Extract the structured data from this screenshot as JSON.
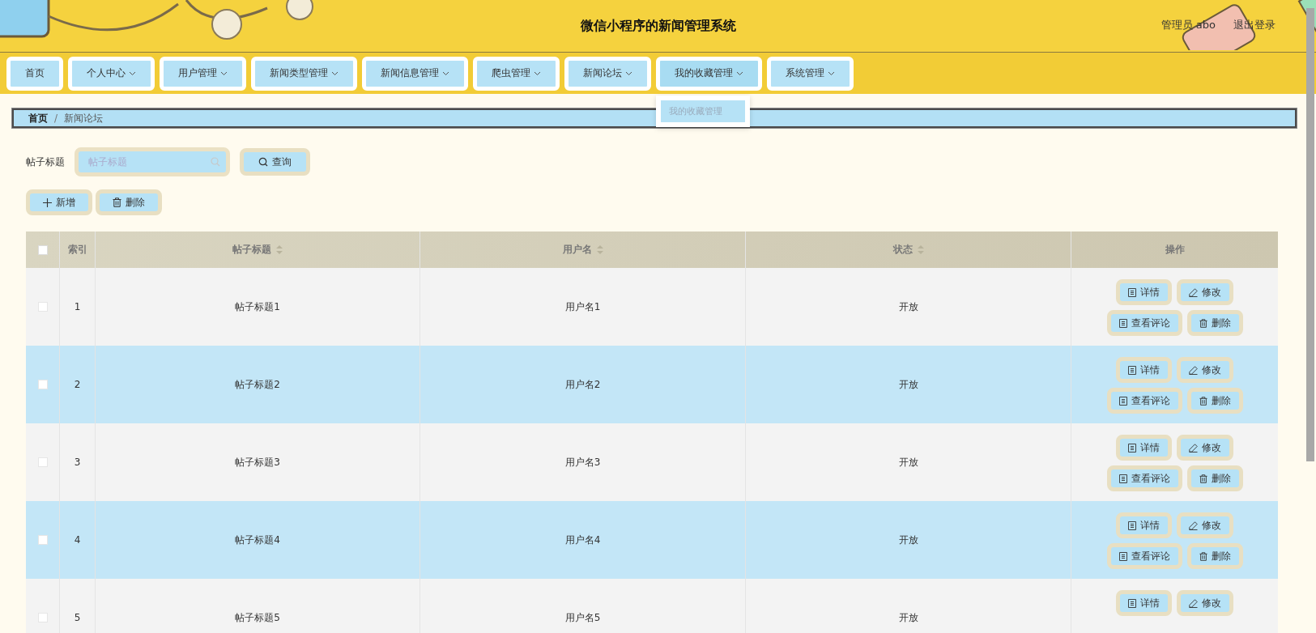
{
  "header": {
    "title": "微信小程序的新闻管理系统",
    "user": "管理员 abo",
    "logout": "退出登录"
  },
  "nav": [
    {
      "label": "首页",
      "dropdown": false,
      "open": false
    },
    {
      "label": "个人中心",
      "dropdown": true,
      "open": false
    },
    {
      "label": "用户管理",
      "dropdown": true,
      "open": false
    },
    {
      "label": "新闻类型管理",
      "dropdown": true,
      "open": false
    },
    {
      "label": "新闻信息管理",
      "dropdown": true,
      "open": false
    },
    {
      "label": "爬虫管理",
      "dropdown": true,
      "open": false
    },
    {
      "label": "新闻论坛",
      "dropdown": true,
      "open": false
    },
    {
      "label": "我的收藏管理",
      "dropdown": true,
      "open": true,
      "items": [
        "我的收藏管理"
      ]
    },
    {
      "label": "系统管理",
      "dropdown": true,
      "open": false
    }
  ],
  "breadcrumb": {
    "items": [
      "首页",
      "新闻论坛"
    ],
    "separator": "/"
  },
  "search": {
    "label": "帖子标题",
    "placeholder": "帖子标题",
    "button": "查询"
  },
  "actions": [
    {
      "kind": "add",
      "label": "新增"
    },
    {
      "kind": "delete",
      "label": "删除"
    }
  ],
  "table": {
    "select_all_checked": false,
    "columns": [
      {
        "label": "索引",
        "sortable": false
      },
      {
        "label": "帖子标题",
        "sortable": true
      },
      {
        "label": "用户名",
        "sortable": true
      },
      {
        "label": "状态",
        "sortable": true
      },
      {
        "label": "操作",
        "sortable": false
      }
    ],
    "rows": [
      {
        "checked": false,
        "index": "1",
        "title": "帖子标题1",
        "user": "用户名1",
        "status": "开放",
        "actions": [
          {
            "kind": "detail",
            "label": "详情"
          },
          {
            "kind": "edit",
            "label": "修改"
          },
          {
            "kind": "comments",
            "label": "查看评论"
          },
          {
            "kind": "delete",
            "label": "删除"
          }
        ]
      },
      {
        "checked": false,
        "index": "2",
        "title": "帖子标题2",
        "user": "用户名2",
        "status": "开放",
        "actions": [
          {
            "kind": "detail",
            "label": "详情"
          },
          {
            "kind": "edit",
            "label": "修改"
          },
          {
            "kind": "comments",
            "label": "查看评论"
          },
          {
            "kind": "delete",
            "label": "删除"
          }
        ]
      },
      {
        "checked": false,
        "index": "3",
        "title": "帖子标题3",
        "user": "用户名3",
        "status": "开放",
        "actions": [
          {
            "kind": "detail",
            "label": "详情"
          },
          {
            "kind": "edit",
            "label": "修改"
          },
          {
            "kind": "comments",
            "label": "查看评论"
          },
          {
            "kind": "delete",
            "label": "删除"
          }
        ]
      },
      {
        "checked": false,
        "index": "4",
        "title": "帖子标题4",
        "user": "用户名4",
        "status": "开放",
        "actions": [
          {
            "kind": "detail",
            "label": "详情"
          },
          {
            "kind": "edit",
            "label": "修改"
          },
          {
            "kind": "comments",
            "label": "查看评论"
          },
          {
            "kind": "delete",
            "label": "删除"
          }
        ]
      },
      {
        "checked": false,
        "index": "5",
        "title": "帖子标题5",
        "user": "用户名5",
        "status": "开放",
        "actions": [
          {
            "kind": "detail",
            "label": "详情"
          },
          {
            "kind": "edit",
            "label": "修改"
          }
        ]
      }
    ]
  }
}
